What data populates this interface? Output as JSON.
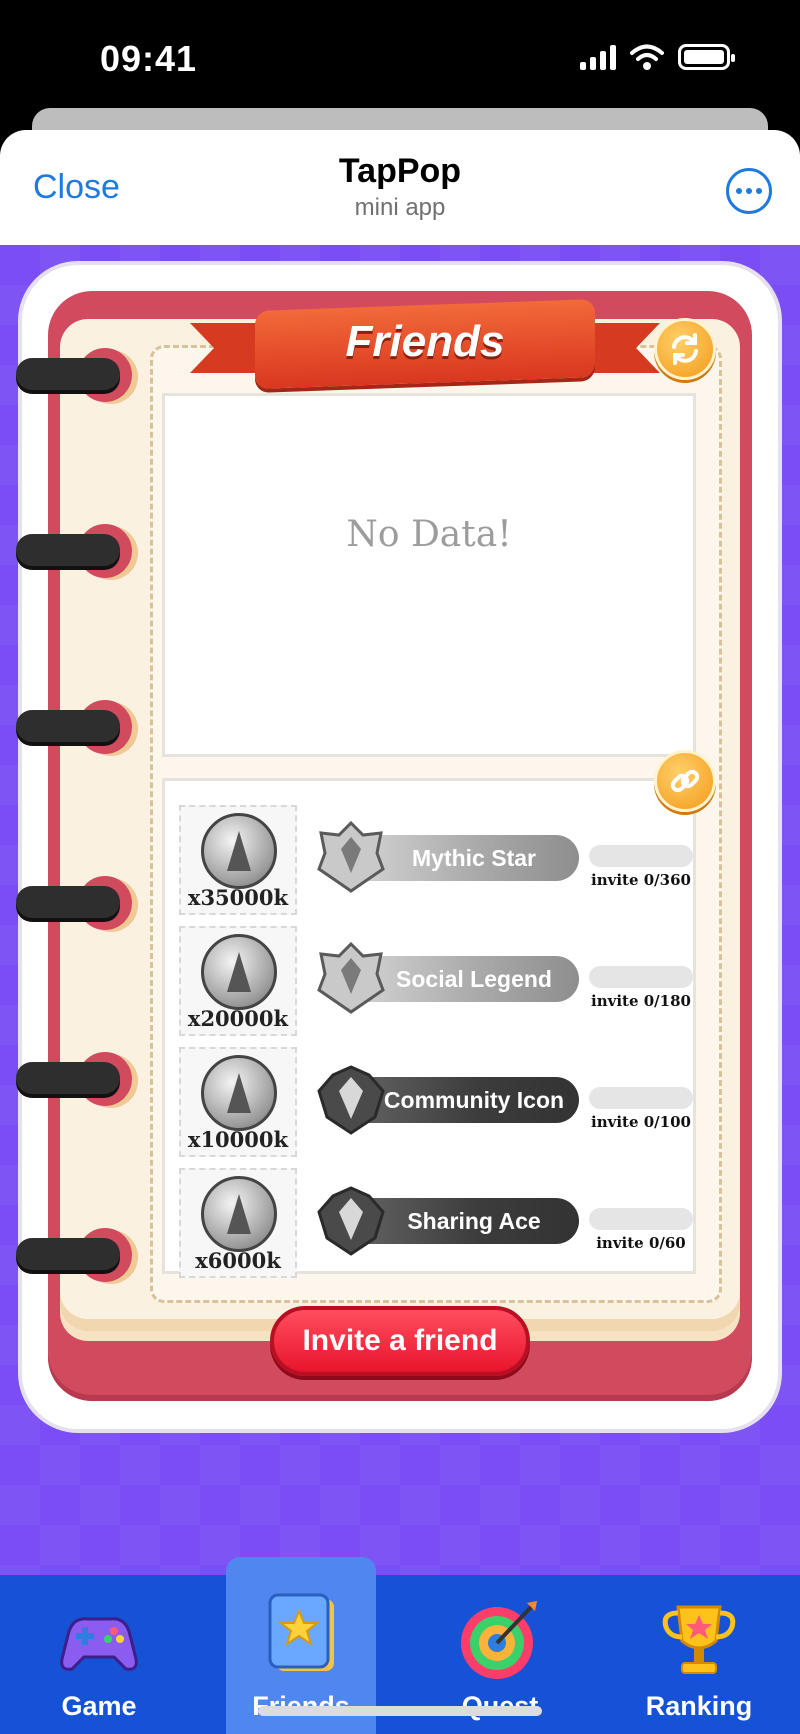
{
  "status_bar": {
    "time": "09:41"
  },
  "header": {
    "close_label": "Close",
    "title": "TapPop",
    "subtitle": "mini app"
  },
  "panel": {
    "title": "Friends",
    "empty_text": "No Data!"
  },
  "rewards": [
    {
      "amount": "x35000k",
      "rank": "Mythic Star",
      "invite": "invite 0/360",
      "progress": 0
    },
    {
      "amount": "x20000k",
      "rank": "Social Legend",
      "invite": "invite 0/180",
      "progress": 0
    },
    {
      "amount": "x10000k",
      "rank": "Community Icon",
      "invite": "invite 0/100",
      "progress": 0
    },
    {
      "amount": "x6000k",
      "rank": "Sharing Ace",
      "invite": "invite 0/60",
      "progress": 0
    }
  ],
  "invite_button": "Invite a friend",
  "nav": [
    {
      "label": "Game",
      "icon": "gamepad-icon"
    },
    {
      "label": "Friends",
      "icon": "friends-book-icon",
      "active": true
    },
    {
      "label": "Quest",
      "icon": "dartboard-icon"
    },
    {
      "label": "Ranking",
      "icon": "trophy-icon"
    }
  ],
  "colors": {
    "accent": "#1f7ae0",
    "background": "#7a4df5",
    "nav": "#1652d6",
    "button": "#e8142c"
  }
}
